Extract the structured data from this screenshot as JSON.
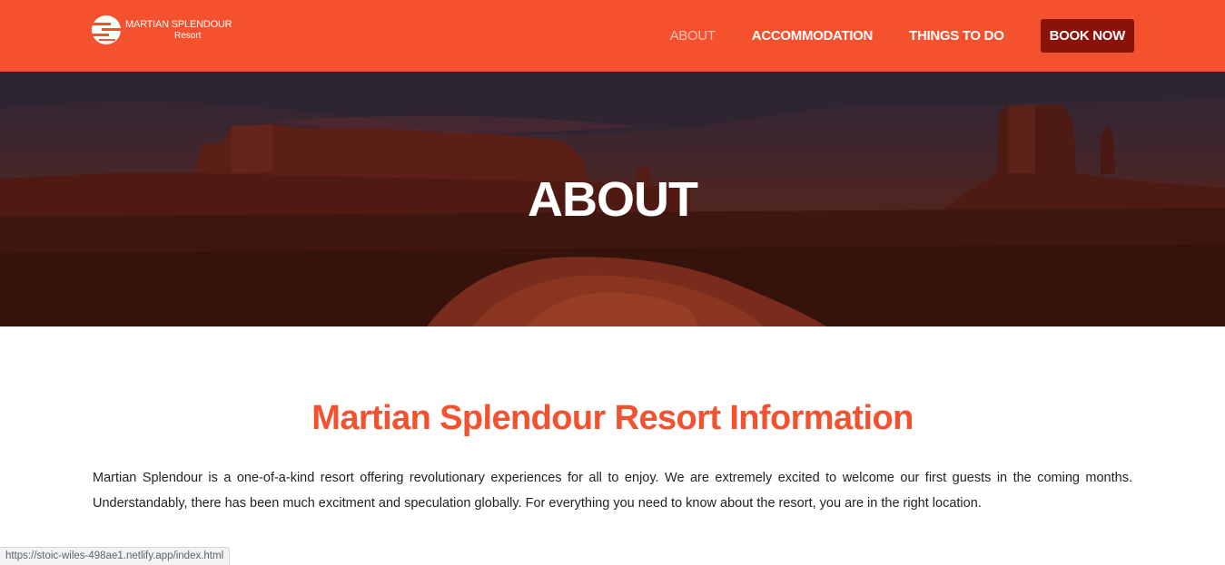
{
  "header": {
    "logo": {
      "name": "MARTIAN SPLENDOUR",
      "sub": "Resort"
    },
    "nav": [
      {
        "label": "ABOUT",
        "active": true
      },
      {
        "label": "ACCOMMODATION"
      },
      {
        "label": "THINGS TO DO"
      },
      {
        "label": "BOOK NOW"
      }
    ]
  },
  "hero": {
    "title": "ABOUT"
  },
  "main": {
    "title": "Martian Splendour Resort Information",
    "body": "Martian Splendour is a one-of-a-kind resort offering revolutionary experiences for all to enjoy. We are extremely excited to welcome our first guests in the coming months. Understandably, there has been much excitment and speculation globally. For everything you need to know about the resort, you are in the right location."
  },
  "status_bar": {
    "url": "https://stoic-wiles-498ae1.netlify.app/index.html"
  },
  "colors": {
    "accent": "#f4512f",
    "book_button": "#8b1208",
    "nav_active": "#fbc2b4"
  }
}
